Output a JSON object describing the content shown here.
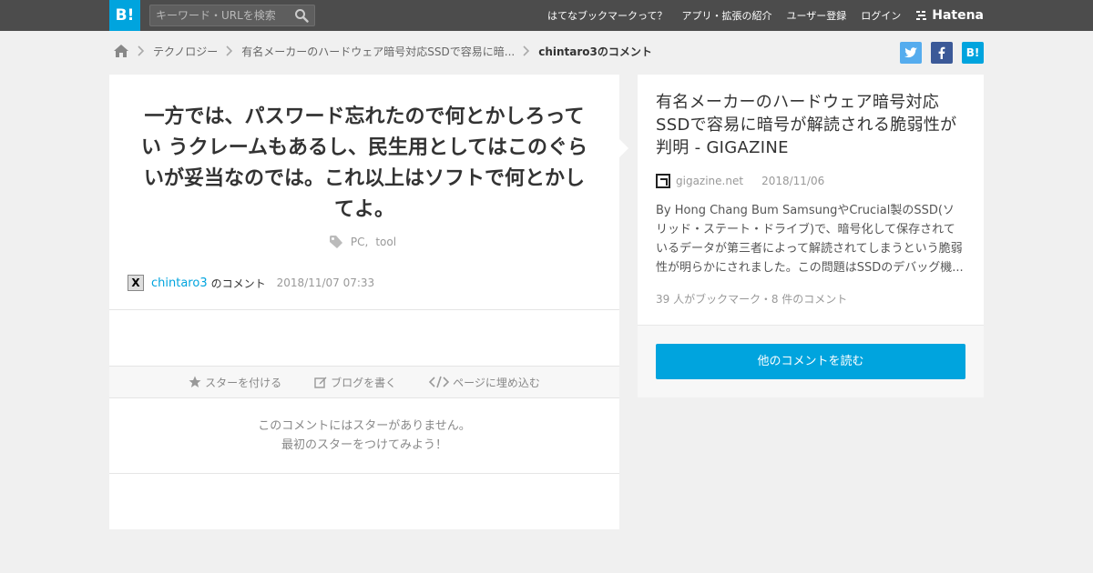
{
  "header": {
    "logo": "B!",
    "search_placeholder": "キーワード・URLを検索",
    "nav": [
      "はてなブックマークって？",
      "アプリ・拡張の紹介",
      "ユーザー登録",
      "ログイン"
    ],
    "brand": "Hatena"
  },
  "breadcrumb": {
    "items": [
      "テクノロジー",
      "有名メーカーのハードウェア暗号対応SSDで容易に暗...",
      "chintaro3のコメント"
    ]
  },
  "share": {
    "twitter": "t",
    "facebook": "f",
    "hatebu": "B!"
  },
  "comment": {
    "text": "一方では、パスワード忘れたので何とかしろってい うクレームもあるし、民生用としてはこのぐらいが妥当なのでは。これ以上はソフトで何とかしてよ。",
    "tags": [
      "PC,",
      "tool"
    ],
    "user": "chintaro3",
    "user_suffix": "のコメント",
    "date": "2018/11/07 07:33",
    "avatar": "X"
  },
  "actions": {
    "star": "スターを付ける",
    "blog": "ブログを書く",
    "embed": "ページに埋め込む"
  },
  "no_star": {
    "line1": "このコメントにはスターがありません。",
    "line2": "最初のスターをつけてみよう！"
  },
  "entry": {
    "title": "有名メーカーのハードウェア暗号対応SSDで容易に暗号が解読される脆弱性が判明 - GIGAZINE",
    "domain": "gigazine.net",
    "date": "2018/11/06",
    "summary": "By Hong Chang Bum SamsungやCrucial製のSSD(ソリッド・ステート・ドライブ)で、暗号化して保存されているデータが第三者によって解読されてしまうという脆弱性が明らかにされました。この問題はSSDのデバッグ機...",
    "counts": "39 人がブックマーク・8 件のコメント",
    "read_button": "他のコメントを読む"
  },
  "colors": {
    "accent": "#00a4de",
    "topbar": "#4c4c4c",
    "background": "#f0f0f0"
  }
}
